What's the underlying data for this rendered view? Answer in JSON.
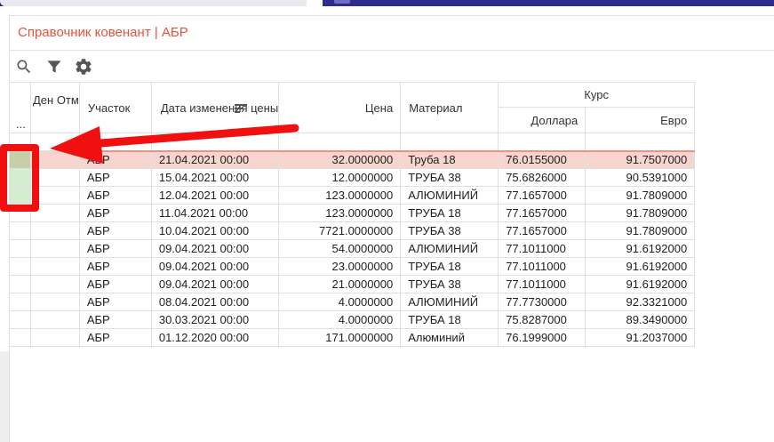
{
  "window": {
    "title": "Справочник ковенант | АБР"
  },
  "toolbar": {
    "icons": [
      "search-icon",
      "filter-icon",
      "gear-icon"
    ]
  },
  "grid": {
    "headers": {
      "dots": "...",
      "den": "Ден Отм",
      "uchastok": "Участок",
      "date": "Дата изменения цены",
      "price": "Цена",
      "material": "Материал",
      "kurs": "Курс",
      "usd": "Доллара",
      "eur": "Евро"
    },
    "rows": [
      {
        "uchastok": "АБР",
        "date": "21.04.2021 00:00",
        "price": "32.0000000",
        "material": "Труба 18",
        "usd": "76.0155000",
        "eur": "91.7507000"
      },
      {
        "uchastok": "АБР",
        "date": "15.04.2021 00:00",
        "price": "12.0000000",
        "material": "ТРУБА 38",
        "usd": "75.6826000",
        "eur": "90.5391000"
      },
      {
        "uchastok": "АБР",
        "date": "12.04.2021 00:00",
        "price": "123.0000000",
        "material": "АЛЮМИНИЙ",
        "usd": "77.1657000",
        "eur": "91.7809000"
      },
      {
        "uchastok": "АБР",
        "date": "11.04.2021 00:00",
        "price": "123.0000000",
        "material": "ТРУБА 18",
        "usd": "77.1657000",
        "eur": "91.7809000"
      },
      {
        "uchastok": "АБР",
        "date": "10.04.2021 00:00",
        "price": "7721.0000000",
        "material": "ТРУБА 38",
        "usd": "77.1657000",
        "eur": "91.7809000"
      },
      {
        "uchastok": "АБР",
        "date": "09.04.2021 00:00",
        "price": "54.0000000",
        "material": "АЛЮМИНИЙ",
        "usd": "77.1011000",
        "eur": "91.6192000"
      },
      {
        "uchastok": "АБР",
        "date": "09.04.2021 00:00",
        "price": "23.0000000",
        "material": "ТРУБА 18",
        "usd": "77.1011000",
        "eur": "91.6192000"
      },
      {
        "uchastok": "АБР",
        "date": "09.04.2021 00:00",
        "price": "21.0000000",
        "material": "ТРУБА 38",
        "usd": "77.1011000",
        "eur": "91.6192000"
      },
      {
        "uchastok": "АБР",
        "date": "08.04.2021 00:00",
        "price": "4.0000000",
        "material": "АЛЮМИНИЙ",
        "usd": "77.7730000",
        "eur": "92.3321000"
      },
      {
        "uchastok": "АБР",
        "date": "30.03.2021 00:00",
        "price": "4.0000000",
        "material": "ТРУБА 18",
        "usd": "75.8287000",
        "eur": "89.3490000"
      },
      {
        "uchastok": "АБР",
        "date": "01.12.2020 00:00",
        "price": "171.0000000",
        "material": "Алюминий",
        "usd": "76.1999000",
        "eur": "91.2037000"
      }
    ],
    "selected_row": 0
  },
  "colors": {
    "title": "#e5533d",
    "topbar": "#2b2d8e",
    "selected_row": "#f6d5cf",
    "annotation": "#f01010"
  }
}
